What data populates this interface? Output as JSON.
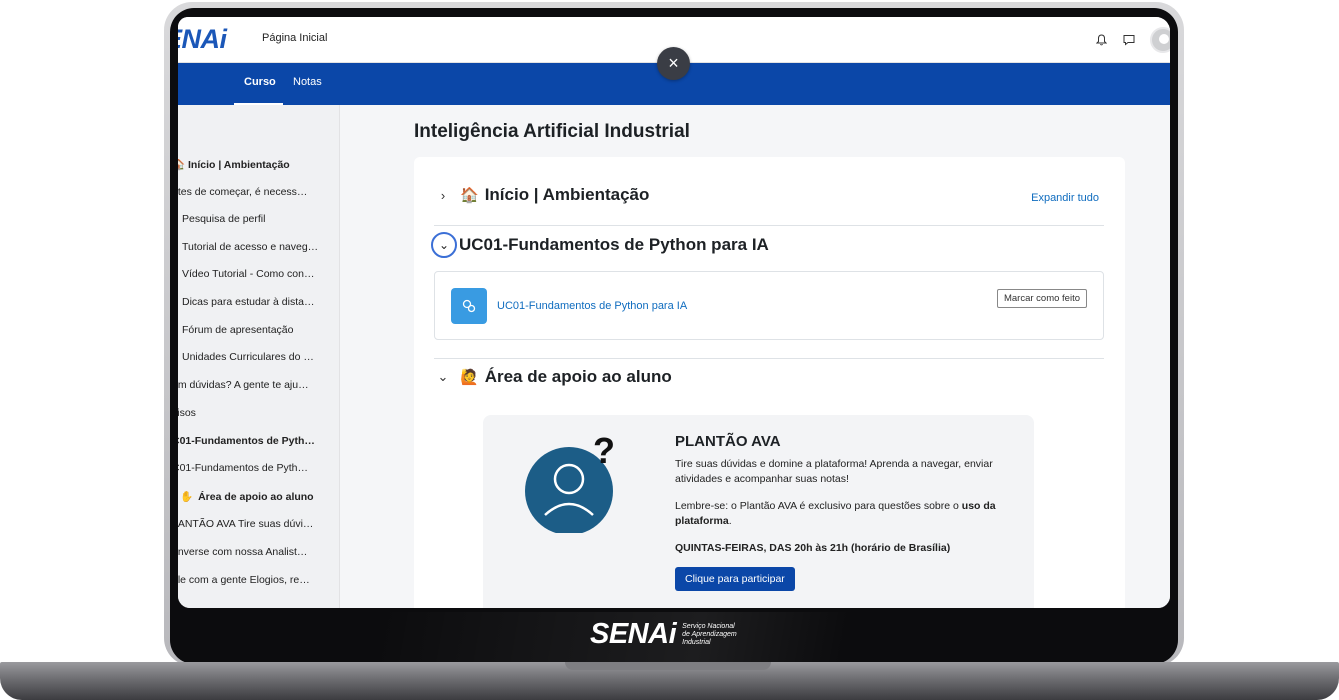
{
  "topbar": {
    "logo_text": "ENAi",
    "home_link": "Página Inicial"
  },
  "secnav": {
    "tabs": [
      {
        "label": "Curso",
        "active": true
      },
      {
        "label": "Notas",
        "active": false
      }
    ]
  },
  "drawer": {
    "items": [
      {
        "label": "🏠 Início | Ambientação",
        "bold": true
      },
      {
        "label": "ntes de começar, é necess…",
        "bold": false
      },
      {
        "label": "Pesquisa de perfil",
        "bold": false
      },
      {
        "label": "Tutorial de acesso e naveg…",
        "bold": false
      },
      {
        "label": "Vídeo Tutorial - Como con…",
        "bold": false
      },
      {
        "label": "Dicas para estudar à dista…",
        "bold": false
      },
      {
        "label": "Fórum de apresentação",
        "bold": false
      },
      {
        "label": "Unidades Curriculares do …",
        "bold": false
      },
      {
        "label": "em dúvidas? A gente te aju…",
        "bold": false
      },
      {
        "label": "visos",
        "bold": false
      },
      {
        "label": "C01-Fundamentos de Pyth…",
        "bold": true
      },
      {
        "label": "C01-Fundamentos de Pyth…",
        "bold": false
      },
      {
        "label": "Área de apoio ao aluno",
        "bold": true
      },
      {
        "label": "LANTÃO AVA Tire suas dúvi…",
        "bold": false
      },
      {
        "label": "onverse com nossa Analist…",
        "bold": false
      },
      {
        "label": "ale com a gente Elogios, re…",
        "bold": false
      }
    ]
  },
  "main": {
    "course_title": "Inteligência Artificial Industrial",
    "expand_all": "Expandir tudo",
    "section1": {
      "emoji": "🏠",
      "title": "Início | Ambientação"
    },
    "section2": {
      "title": "UC01-Fundamentos de Python para IA"
    },
    "activity": {
      "name": "UC01-Fundamentos de Python para IA",
      "mark_done": "Marcar como feito"
    },
    "section3": {
      "emoji": "🙋",
      "title": "Área de apoio ao aluno"
    },
    "plantao": {
      "title": "PLANTÃO AVA",
      "text1": "Tire suas dúvidas e domine a plataforma! Aprenda a navegar, enviar atividades e acompanhar suas notas!",
      "text2_pre": "Lembre-se: o Plantão AVA é exclusivo para questões sobre o ",
      "text2_bold": "uso da plataforma",
      "text2_post": ".",
      "schedule": "QUINTAS-FEIRAS, DAS 20h às 21h (horário de Brasília)",
      "button": "Clique para participar"
    }
  },
  "brand": {
    "word": "SENAi",
    "sub1": "Serviço Nacional",
    "sub2": "de Aprendizagem",
    "sub3": "Industrial"
  },
  "colors": {
    "primary": "#0b47a8",
    "link": "#0f6cbf",
    "activity_icon": "#399be2",
    "illustration": "#1c5d87"
  }
}
